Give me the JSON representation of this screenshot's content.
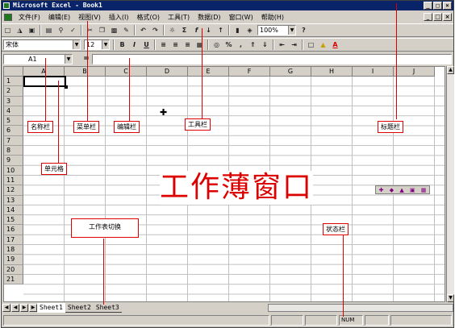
{
  "window": {
    "title": "Microsoft Excel - Book1",
    "min_btn": "_",
    "max_btn": "□",
    "close_btn": "×"
  },
  "menubar": {
    "items": [
      {
        "label": "文件(F)"
      },
      {
        "label": "编辑(E)"
      },
      {
        "label": "视图(V)"
      },
      {
        "label": "插入(I)"
      },
      {
        "label": "格式(O)"
      },
      {
        "label": "工具(T)"
      },
      {
        "label": "数据(D)"
      },
      {
        "label": "窗口(W)"
      },
      {
        "label": "帮助(H)"
      }
    ]
  },
  "toolbar": {
    "icons": [
      "new-icon",
      "open-icon",
      "save-icon",
      "print-icon",
      "print-preview-icon",
      "spelling-icon",
      "cut-icon",
      "copy-icon",
      "paste-icon",
      "format-painter-icon",
      "undo-icon",
      "redo-icon",
      "hyperlink-icon",
      "autosum-icon",
      "function-icon",
      "sort-asc-icon",
      "sort-desc-icon",
      "chart-wizard-icon",
      "drawing-icon"
    ],
    "zoom": "100%",
    "help_label": "?"
  },
  "format_toolbar": {
    "font": "宋体",
    "size": "12",
    "bold": "B",
    "italic": "I",
    "underline": "U",
    "percent": "%",
    "comma": ",",
    "font_color": "A"
  },
  "formula_bar": {
    "name_box": "A1",
    "equals": "=",
    "formula": ""
  },
  "grid": {
    "columns": [
      "A",
      "B",
      "C",
      "D",
      "E",
      "F",
      "G",
      "H",
      "I",
      "J"
    ],
    "rows": [
      "1",
      "2",
      "3",
      "4",
      "5",
      "6",
      "7",
      "8",
      "9",
      "10",
      "11",
      "12",
      "13",
      "14",
      "15",
      "16",
      "17",
      "18",
      "19",
      "20",
      "21"
    ],
    "active_cell": "A1"
  },
  "sheet_tabs": {
    "tabs": [
      "Sheet1",
      "Sheet2",
      "Sheet3"
    ],
    "active": "Sheet1"
  },
  "status_bar": {
    "mode": "",
    "num": "NUM"
  },
  "annotations": {
    "name_box": "名称栏",
    "menu_bar": "菜单栏",
    "edit_bar": "编辑栏",
    "toolbar": "工具栏",
    "title_bar": "标题栏",
    "cell": "单元格",
    "sheet_switch": "工作表切换",
    "status_bar": "状态栏",
    "workbook_window": "工作薄窗口"
  },
  "colors": {
    "title_bg": "#0a246a",
    "chrome": "#d4d0c8",
    "annotation_red": "#dd0000"
  }
}
